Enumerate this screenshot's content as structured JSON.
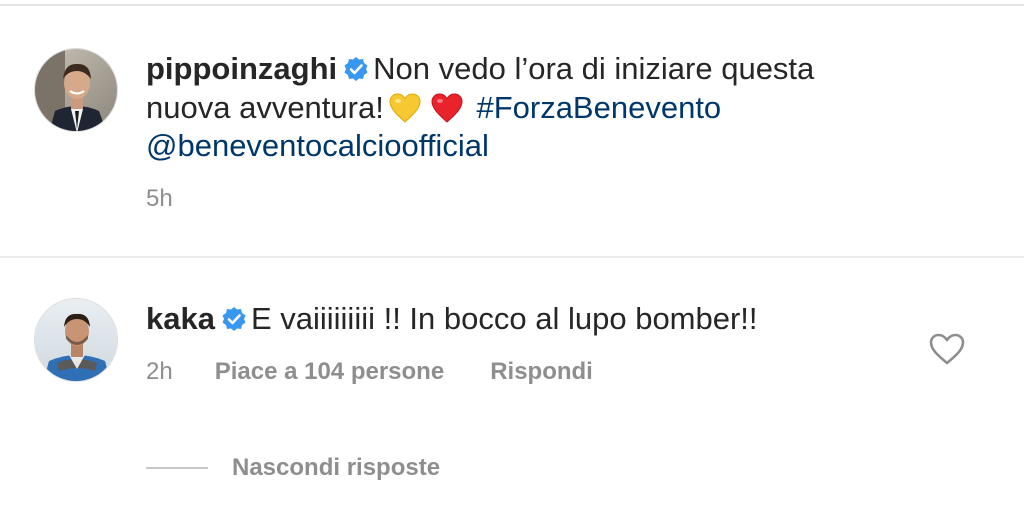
{
  "caption": {
    "username": "pippoinzaghi",
    "text_line1": "Non vedo l’ora di iniziare questa",
    "text_line2": "nuova avventura!",
    "hashtag": "#ForzaBenevento",
    "mention": "@beneventocalcioofficial",
    "time": "5h",
    "emojis": [
      "yellow-heart-icon",
      "red-heart-icon"
    ]
  },
  "comment": {
    "username": "kaka",
    "text": "E vaiiiiiiiii !! In bocco al lupo bomber!!",
    "time": "2h",
    "likes_label": "Piace a 104 persone",
    "reply_label": "Rispondi"
  },
  "replies": {
    "toggle_label": "Nascondi risposte"
  },
  "colors": {
    "link": "#00376b",
    "verified": "#3897f0",
    "meta": "#8e8e8e",
    "text": "#262626"
  }
}
